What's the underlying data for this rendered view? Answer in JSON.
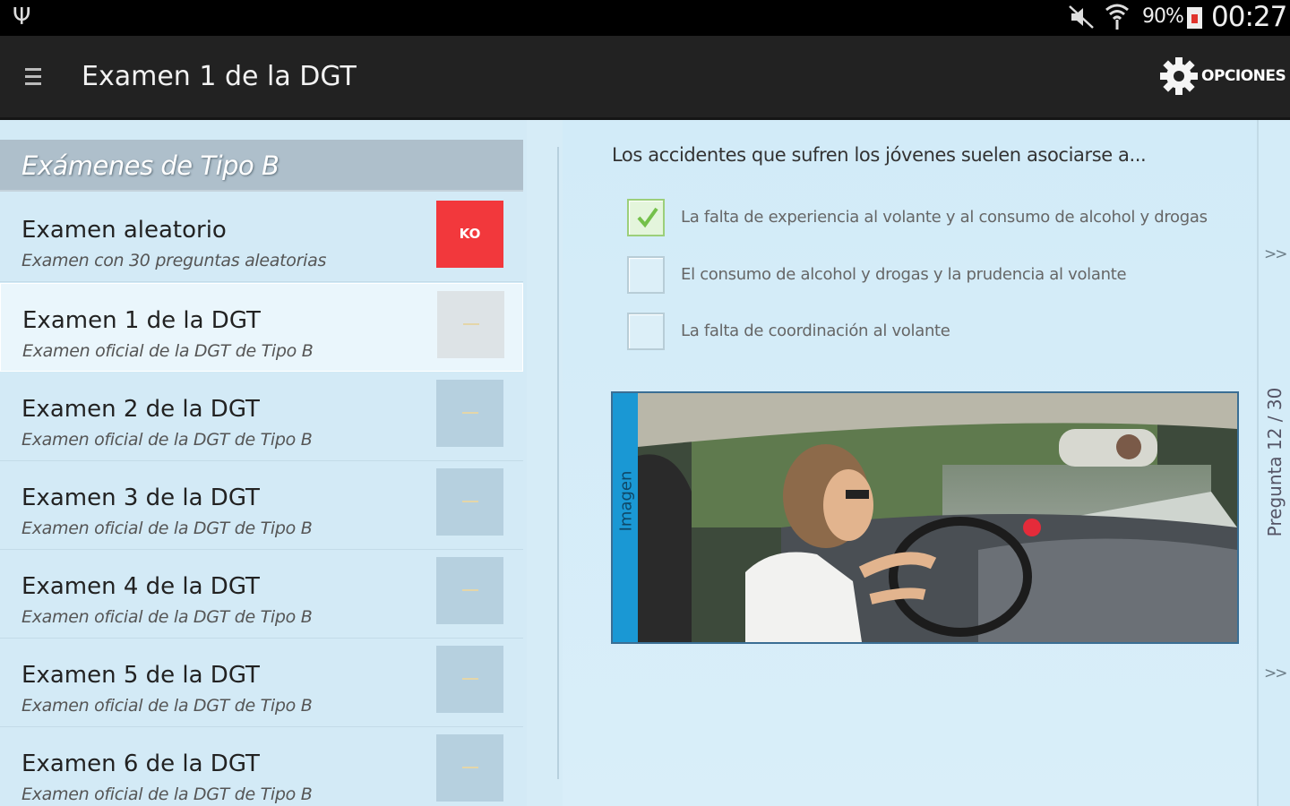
{
  "status_bar": {
    "icons": [
      "usb-icon",
      "mute-icon",
      "wifi-icon",
      "battery-icon"
    ],
    "battery_percent": "90%",
    "time": "00:27"
  },
  "action_bar": {
    "title": "Examen 1 de la DGT",
    "options_label": "OPCIONES",
    "icons": [
      "menu-icon",
      "gear-icon"
    ]
  },
  "sidebar": {
    "section_title": "Exámenes de Tipo B",
    "items": [
      {
        "title": "Examen aleatorio",
        "subtitle": "Examen con 30 preguntas aleatorias",
        "badge": "KO",
        "badge_color": "#f2383c"
      },
      {
        "title": "Examen 1 de la DGT",
        "subtitle": "Examen oficial de la DGT de Tipo B",
        "badge": "",
        "selected": true
      },
      {
        "title": "Examen 2 de la DGT",
        "subtitle": "Examen oficial de la DGT de Tipo B",
        "badge": ""
      },
      {
        "title": "Examen 3 de la DGT",
        "subtitle": "Examen oficial de la DGT de Tipo B",
        "badge": ""
      },
      {
        "title": "Examen 4 de la DGT",
        "subtitle": "Examen oficial de la DGT de Tipo B",
        "badge": ""
      },
      {
        "title": "Examen 5 de la DGT",
        "subtitle": "Examen oficial de la DGT de Tipo B",
        "badge": ""
      },
      {
        "title": "Examen 6 de la DGT",
        "subtitle": "Examen oficial de la DGT de Tipo B",
        "badge": ""
      }
    ]
  },
  "question": {
    "text": "Los accidentes que sufren los jóvenes suelen asociarse a...",
    "answers": [
      {
        "text": "La falta de experiencia al volante y al consumo de alcohol y drogas",
        "checked": true
      },
      {
        "text": "El consumo de alcohol y drogas y la prudencia al volante",
        "checked": false
      },
      {
        "text": "La falta de coordinación al volante",
        "checked": false
      }
    ],
    "image_tab_label": "Imagen"
  },
  "navigation": {
    "next_top": ">>",
    "next_bottom": ">>",
    "counter": "Pregunta 12 / 30"
  },
  "colors": {
    "accent_blue": "#1a98d4",
    "ko_red": "#f2383c",
    "check_green": "#74c04a"
  }
}
